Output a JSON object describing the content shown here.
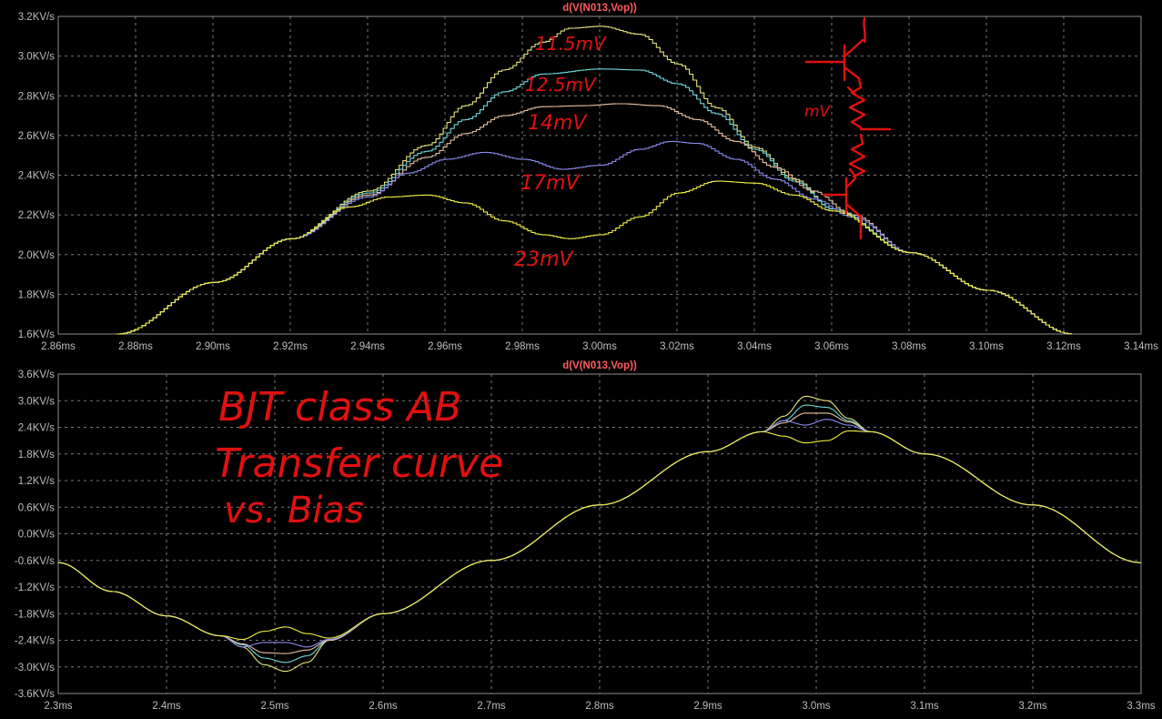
{
  "chart_data": [
    {
      "type": "line",
      "title": "d(V(N013,Vop))",
      "xlim": [
        2.86,
        3.14
      ],
      "ylim": [
        1.6,
        3.2
      ],
      "x_ticks": [
        "2.86ms",
        "2.88ms",
        "2.90ms",
        "2.92ms",
        "2.94ms",
        "2.96ms",
        "2.98ms",
        "3.00ms",
        "3.02ms",
        "3.04ms",
        "3.06ms",
        "3.08ms",
        "3.10ms",
        "3.12ms",
        "3.14ms"
      ],
      "y_ticks": [
        "1.6KV/s",
        "1.8KV/s",
        "2.0KV/s",
        "2.2KV/s",
        "2.4KV/s",
        "2.6KV/s",
        "2.8KV/s",
        "3.0KV/s",
        "3.2KV/s"
      ],
      "series": [
        {
          "name": "11.5mV",
          "color": "#e6e67a",
          "x": [
            2.875,
            2.9,
            2.92,
            2.94,
            2.955,
            2.965,
            2.975,
            2.985,
            2.992,
            3.0,
            3.01,
            3.02,
            3.03,
            3.04,
            3.05,
            3.06,
            3.08,
            3.1,
            3.122
          ],
          "y": [
            1.6,
            1.86,
            2.08,
            2.32,
            2.55,
            2.75,
            2.93,
            3.07,
            3.14,
            3.15,
            3.11,
            2.96,
            2.74,
            2.54,
            2.38,
            2.23,
            2.01,
            1.82,
            1.6
          ]
        },
        {
          "name": "12.5mV",
          "color": "#6fd8d8",
          "x": [
            2.875,
            2.9,
            2.92,
            2.94,
            2.955,
            2.965,
            2.975,
            2.985,
            3.0,
            3.01,
            3.02,
            3.03,
            3.04,
            3.05,
            3.06,
            3.08,
            3.1,
            3.122
          ],
          "y": [
            1.6,
            1.86,
            2.08,
            2.31,
            2.52,
            2.68,
            2.82,
            2.91,
            2.935,
            2.93,
            2.86,
            2.71,
            2.53,
            2.37,
            2.23,
            2.01,
            1.82,
            1.6
          ]
        },
        {
          "name": "14mV",
          "color": "#e8c0a0",
          "x": [
            2.875,
            2.9,
            2.92,
            2.94,
            2.955,
            2.965,
            2.975,
            2.985,
            2.995,
            3.005,
            3.015,
            3.025,
            3.035,
            3.045,
            3.055,
            3.065,
            3.08,
            3.1,
            3.122
          ],
          "y": [
            1.6,
            1.86,
            2.08,
            2.3,
            2.49,
            2.61,
            2.7,
            2.745,
            2.75,
            2.76,
            2.75,
            2.68,
            2.57,
            2.44,
            2.32,
            2.2,
            2.01,
            1.82,
            1.6
          ]
        },
        {
          "name": "17mV",
          "color": "#8a8af0",
          "x": [
            2.875,
            2.9,
            2.92,
            2.94,
            2.95,
            2.96,
            2.97,
            2.98,
            2.99,
            3.0,
            3.01,
            3.018,
            3.025,
            3.035,
            3.045,
            3.055,
            3.065,
            3.08,
            3.1,
            3.122
          ],
          "y": [
            1.6,
            1.86,
            2.08,
            2.29,
            2.41,
            2.48,
            2.515,
            2.48,
            2.43,
            2.45,
            2.53,
            2.57,
            2.56,
            2.48,
            2.38,
            2.28,
            2.19,
            2.01,
            1.82,
            1.6
          ]
        },
        {
          "name": "23mV",
          "color": "#f0f040",
          "x": [
            2.875,
            2.9,
            2.92,
            2.935,
            2.945,
            2.955,
            2.965,
            2.975,
            2.985,
            2.992,
            3.0,
            3.01,
            3.02,
            3.03,
            3.04,
            3.05,
            3.06,
            3.08,
            3.1,
            3.122
          ],
          "y": [
            1.6,
            1.86,
            2.08,
            2.24,
            2.29,
            2.3,
            2.26,
            2.17,
            2.1,
            2.08,
            2.1,
            2.19,
            2.31,
            2.37,
            2.36,
            2.3,
            2.22,
            2.01,
            1.82,
            1.6
          ]
        }
      ]
    },
    {
      "type": "line",
      "title": "d(V(N013,Vop))",
      "xlim": [
        2.3,
        3.3
      ],
      "ylim": [
        -3.6,
        3.6
      ],
      "x_ticks": [
        "2.3ms",
        "2.4ms",
        "2.5ms",
        "2.6ms",
        "2.7ms",
        "2.8ms",
        "2.9ms",
        "3.0ms",
        "3.1ms",
        "3.2ms",
        "3.3ms"
      ],
      "y_ticks": [
        "-3.6KV/s",
        "-3.0KV/s",
        "-2.4KV/s",
        "-1.8KV/s",
        "-1.2KV/s",
        "-0.6KV/s",
        "0.0KV/s",
        "0.6KV/s",
        "1.2KV/s",
        "1.8KV/s",
        "2.4KV/s",
        "3.0KV/s",
        "3.6KV/s"
      ],
      "series": [
        {
          "name": "11.5mV",
          "color": "#e6e67a",
          "x": [
            2.3,
            2.35,
            2.4,
            2.45,
            2.47,
            2.49,
            2.51,
            2.53,
            2.55,
            2.6,
            2.7,
            2.8,
            2.9,
            2.95,
            2.97,
            2.99,
            3.01,
            3.03,
            3.05,
            3.1,
            3.2,
            3.3
          ],
          "y": [
            -0.65,
            -1.3,
            -1.85,
            -2.3,
            -2.55,
            -2.95,
            -3.1,
            -2.9,
            -2.4,
            -1.8,
            -0.6,
            0.65,
            1.85,
            2.3,
            2.65,
            3.1,
            3.0,
            2.6,
            2.3,
            1.8,
            0.65,
            -0.65
          ]
        },
        {
          "name": "12.5mV",
          "color": "#6fd8d8",
          "x": [
            2.3,
            2.35,
            2.4,
            2.45,
            2.47,
            2.49,
            2.51,
            2.53,
            2.55,
            2.6,
            2.7,
            2.8,
            2.9,
            2.95,
            2.97,
            2.99,
            3.01,
            3.03,
            3.05,
            3.1,
            3.2,
            3.3
          ],
          "y": [
            -0.65,
            -1.3,
            -1.85,
            -2.3,
            -2.5,
            -2.8,
            -2.9,
            -2.75,
            -2.4,
            -1.8,
            -0.6,
            0.65,
            1.85,
            2.3,
            2.55,
            2.9,
            2.85,
            2.55,
            2.3,
            1.8,
            0.65,
            -0.65
          ]
        },
        {
          "name": "14mV",
          "color": "#e8c0a0",
          "x": [
            2.3,
            2.35,
            2.4,
            2.45,
            2.47,
            2.49,
            2.51,
            2.53,
            2.55,
            2.6,
            2.7,
            2.8,
            2.9,
            2.95,
            2.97,
            2.99,
            3.01,
            3.03,
            3.05,
            3.1,
            3.2,
            3.3
          ],
          "y": [
            -0.65,
            -1.3,
            -1.85,
            -2.3,
            -2.48,
            -2.68,
            -2.7,
            -2.62,
            -2.4,
            -1.8,
            -0.6,
            0.65,
            1.85,
            2.3,
            2.5,
            2.72,
            2.72,
            2.52,
            2.3,
            1.8,
            0.65,
            -0.65
          ]
        },
        {
          "name": "17mV",
          "color": "#8a8af0",
          "x": [
            2.3,
            2.35,
            2.4,
            2.45,
            2.47,
            2.49,
            2.51,
            2.53,
            2.55,
            2.6,
            2.7,
            2.8,
            2.9,
            2.95,
            2.97,
            2.99,
            3.01,
            3.03,
            3.05,
            3.1,
            3.2,
            3.3
          ],
          "y": [
            -0.65,
            -1.3,
            -1.85,
            -2.3,
            -2.55,
            -2.45,
            -2.45,
            -2.55,
            -2.38,
            -1.8,
            -0.6,
            0.65,
            1.85,
            2.3,
            2.55,
            2.45,
            2.58,
            2.45,
            2.3,
            1.8,
            0.65,
            -0.65
          ]
        },
        {
          "name": "23mV",
          "color": "#f0f040",
          "x": [
            2.3,
            2.35,
            2.4,
            2.45,
            2.47,
            2.49,
            2.51,
            2.53,
            2.55,
            2.6,
            2.7,
            2.8,
            2.9,
            2.95,
            2.97,
            2.99,
            3.01,
            3.03,
            3.05,
            3.1,
            3.2,
            3.3
          ],
          "y": [
            -0.65,
            -1.3,
            -1.85,
            -2.3,
            -2.38,
            -2.2,
            -2.1,
            -2.25,
            -2.35,
            -1.8,
            -0.6,
            0.65,
            1.85,
            2.3,
            2.2,
            2.05,
            2.1,
            2.32,
            2.3,
            1.8,
            0.65,
            -0.65
          ]
        }
      ]
    }
  ],
  "annotations": {
    "top": [
      "11.5mV",
      "12.5mV",
      "14mV",
      "17mV",
      "23mV",
      "mV"
    ],
    "bottom": [
      "BJT class AB",
      "Transfer curve",
      "vs. Bias"
    ]
  }
}
